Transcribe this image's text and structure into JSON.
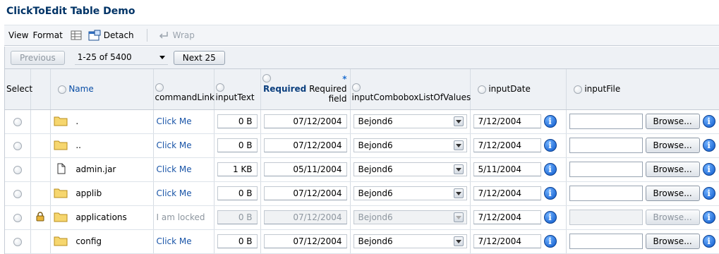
{
  "page": {
    "title": "ClickToEdit Table Demo"
  },
  "toolbar": {
    "view_label": "View",
    "format_label": "Format",
    "detach_label": "Detach",
    "wrap_label": "Wrap"
  },
  "pager": {
    "previous_label": "Previous",
    "range_value": "1-25 of 5400",
    "next_label": "Next 25"
  },
  "columns": {
    "select": "Select",
    "name": "Name",
    "commandLink": "commandLink",
    "inputText": "inputText",
    "required_star": "*",
    "required_bold": "Required",
    "required_text1": "Required",
    "required_text2": "field",
    "combo": "inputComboboxListOfValues",
    "inputDate": "inputDate",
    "inputFile": "inputFile"
  },
  "rows": [
    {
      "name": ".",
      "link": "Click Me",
      "size": "0 B",
      "date": "07/12/2004",
      "combo": "Bejond6",
      "input_date": "7/12/2004",
      "browse": "Browse..."
    },
    {
      "name": "..",
      "link": "Click Me",
      "size": "0 B",
      "date": "07/12/2004",
      "combo": "Bejond6",
      "input_date": "7/12/2004",
      "browse": "Browse..."
    },
    {
      "name": "admin.jar",
      "link": "Click Me",
      "size": "1 KB",
      "date": "05/11/2004",
      "combo": "Bejond6",
      "input_date": "5/11/2004",
      "browse": "Browse..."
    },
    {
      "name": "applib",
      "link": "Click Me",
      "size": "0 B",
      "date": "07/12/2004",
      "combo": "Bejond6",
      "input_date": "7/12/2004",
      "browse": "Browse..."
    },
    {
      "name": "applications",
      "link": "I am locked",
      "size": "0 B",
      "date": "07/12/2004",
      "combo": "Bejond6",
      "input_date": "7/12/2004",
      "browse": "Browse..."
    },
    {
      "name": "config",
      "link": "Click Me",
      "size": "0 B",
      "date": "07/12/2004",
      "combo": "Bejond6",
      "input_date": "7/12/2004",
      "browse": "Browse..."
    }
  ],
  "icons": {
    "file": "file-icon",
    "folder": "folder-icon",
    "lock": "lock-icon",
    "info": "info-icon"
  },
  "colors": {
    "title": "#003366",
    "link": "#1a55a8",
    "header_bg": "#eef1f5"
  }
}
